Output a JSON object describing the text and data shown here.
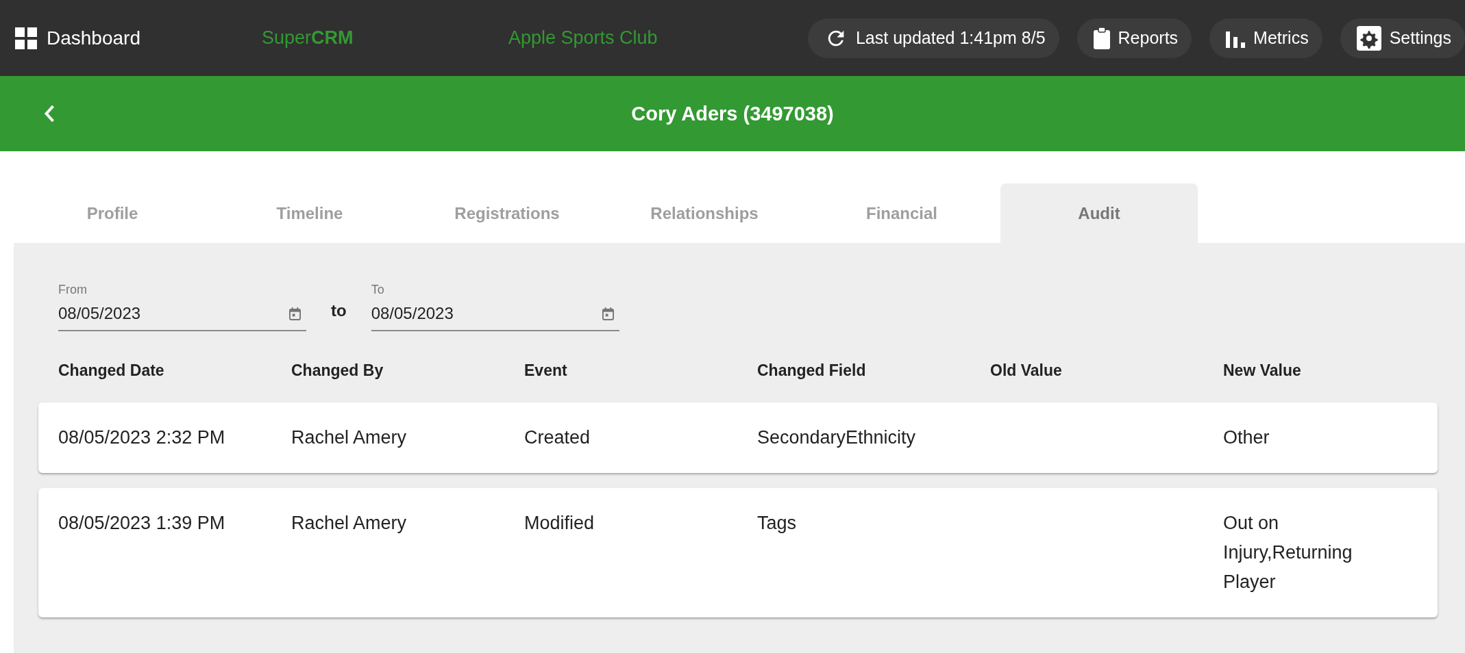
{
  "topbar": {
    "dashboard": "Dashboard",
    "brand_prefix": "Super",
    "brand_suffix": "CRM",
    "club": "Apple Sports Club",
    "actions": [
      {
        "kind": "refresh",
        "label": "Last updated 1:41pm 8/5"
      },
      {
        "kind": "reports",
        "label": "Reports"
      },
      {
        "kind": "metrics",
        "label": "Metrics"
      },
      {
        "kind": "settings",
        "label": "Settings"
      }
    ]
  },
  "header": {
    "title": "Cory Aders (3497038)"
  },
  "tabs": [
    {
      "label": "Profile",
      "selected": false
    },
    {
      "label": "Timeline",
      "selected": false
    },
    {
      "label": "Registrations",
      "selected": false
    },
    {
      "label": "Relationships",
      "selected": false
    },
    {
      "label": "Financial",
      "selected": false
    },
    {
      "label": "Audit",
      "selected": true
    }
  ],
  "filters": {
    "from": {
      "label": "From",
      "value": "08/05/2023"
    },
    "separator": "to",
    "to": {
      "label": "To",
      "value": "08/05/2023"
    }
  },
  "table": {
    "columns": [
      "Changed Date",
      "Changed By",
      "Event",
      "Changed Field",
      "Old Value",
      "New Value"
    ],
    "rows": [
      [
        "08/05/2023 2:32 PM",
        "Rachel Amery",
        "Created",
        "SecondaryEthnicity",
        "",
        "Other"
      ],
      [
        "08/05/2023 1:39 PM",
        "Rachel Amery",
        "Modified",
        "Tags",
        "",
        "Out on Injury,Returning Player"
      ]
    ]
  }
}
